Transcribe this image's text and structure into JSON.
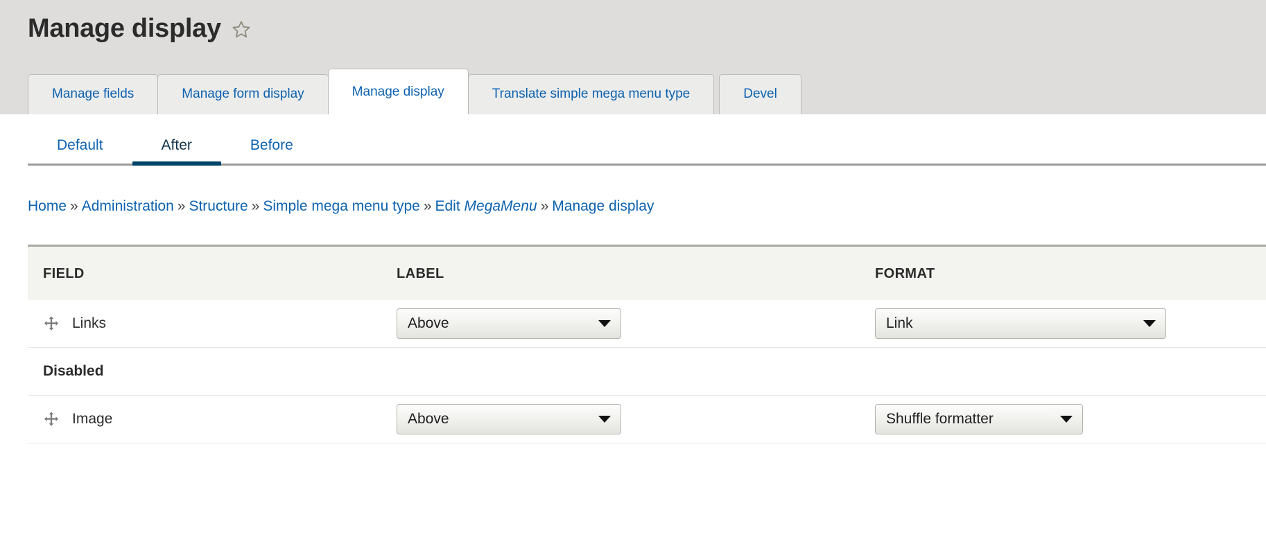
{
  "header": {
    "title": "Manage display",
    "favorite_icon": "star-icon"
  },
  "primary_tabs": [
    {
      "label": "Manage fields",
      "active": false
    },
    {
      "label": "Manage form display",
      "active": false
    },
    {
      "label": "Manage display",
      "active": true
    },
    {
      "label": "Translate simple mega menu type",
      "active": false
    },
    {
      "label": "Devel",
      "active": false
    }
  ],
  "secondary_tabs": [
    {
      "label": "Default",
      "active": false
    },
    {
      "label": "After",
      "active": true
    },
    {
      "label": "Before",
      "active": false
    }
  ],
  "breadcrumb": {
    "separator": "»",
    "items": [
      {
        "label": "Home",
        "italic": false
      },
      {
        "label": "Administration",
        "italic": false
      },
      {
        "label": "Structure",
        "italic": false
      },
      {
        "label": "Simple mega menu type",
        "italic": false
      },
      {
        "label": "Edit",
        "italic": false,
        "suffix": "MegaMenu",
        "suffix_italic": true
      },
      {
        "label": "Manage display",
        "italic": false
      }
    ]
  },
  "table": {
    "headers": {
      "field": "FIELD",
      "label": "LABEL",
      "format": "FORMAT"
    },
    "rows": [
      {
        "type": "field",
        "name": "Links",
        "drag_icon": "move-handle-icon",
        "label_select": "Above",
        "format_select": "Link"
      },
      {
        "type": "region",
        "name": "Disabled"
      },
      {
        "type": "field",
        "name": "Image",
        "drag_icon": "move-handle-icon",
        "label_select": "Above",
        "format_select": "Shuffle formatter"
      }
    ]
  },
  "colors": {
    "header_bg": "#dedddb",
    "link": "#0c62b0",
    "active_underline": "#004369",
    "table_header_bg": "#f3f4ef",
    "text": "#2b2b2b"
  }
}
